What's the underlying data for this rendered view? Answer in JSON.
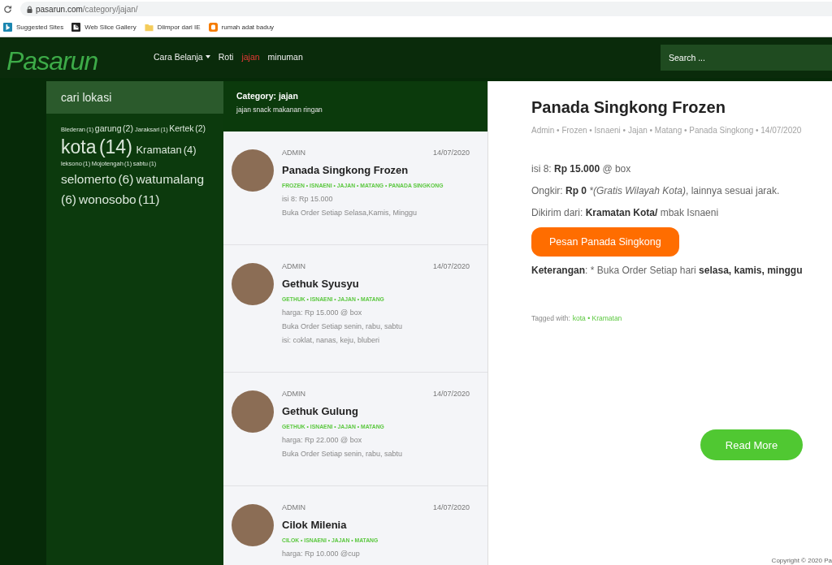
{
  "browser": {
    "url_host": "pasarun.com",
    "url_path": "/category/jajan/",
    "bookmarks": [
      {
        "label": "Suggested Sites",
        "kind": "tile"
      },
      {
        "label": "Web Slice Gallery",
        "kind": "page"
      },
      {
        "label": "Diimpor dari IE",
        "kind": "folder"
      },
      {
        "label": "rumah adat baduy",
        "kind": "badge"
      }
    ]
  },
  "header": {
    "logo": "Pasarun",
    "nav": [
      {
        "label": "Cara Belanja",
        "dropdown": true,
        "selected": false
      },
      {
        "label": "Roti",
        "dropdown": false,
        "selected": false
      },
      {
        "label": "jajan",
        "dropdown": false,
        "selected": true
      },
      {
        "label": "minuman",
        "dropdown": false,
        "selected": false
      }
    ],
    "search": {
      "placeholder": "Search ..."
    }
  },
  "sidebar": {
    "title": "cari lokasi",
    "tags": [
      {
        "name": "Blederan",
        "count": "(1)",
        "kind": "tiny"
      },
      {
        "name": "garung",
        "count": "(2)",
        "kind": "small"
      },
      {
        "name": "Jaraksari",
        "count": "(1)",
        "kind": "tiny"
      },
      {
        "name": "Kertek",
        "count": "(2)",
        "kind": "small"
      },
      {
        "name": "kota",
        "count": "(14)",
        "kind": "huge"
      },
      {
        "name": "Kramatan",
        "count": "(4)",
        "kind": "medium"
      },
      {
        "name": "leksono",
        "count": "(1)",
        "kind": "tiny"
      },
      {
        "name": "Mojotengah",
        "count": "(1)",
        "kind": "tiny"
      },
      {
        "name": "sabtu",
        "count": "(1)",
        "kind": "tiny"
      },
      {
        "name": "selomerto",
        "count": "(6)",
        "kind": "large"
      },
      {
        "name": "watumalang",
        "count": "(6)",
        "kind": "large"
      },
      {
        "name": "wonosobo",
        "count": "(11)",
        "kind": "large"
      }
    ]
  },
  "category": {
    "title": "Category: jajan",
    "description": "jajan snack makanan ringan"
  },
  "posts": [
    {
      "author": "ADMIN",
      "date": "14/07/2020",
      "title": "Panada Singkong Frozen",
      "tags": "FROZEN • ISNAENI • JAJAN • MATANG • PANADA SINGKONG",
      "lines": [
        "isi 8: Rp 15.000",
        "Buka Order Setiap Selasa,Kamis, Minggu"
      ]
    },
    {
      "author": "ADMIN",
      "date": "14/07/2020",
      "title": "Gethuk Syusyu",
      "tags": "GETHUK • ISNAENI • JAJAN • MATANG",
      "lines": [
        "harga: Rp 15.000 @ box",
        "Buka Order Setiap senin, rabu, sabtu",
        "isi: coklat, nanas, keju, bluberi"
      ]
    },
    {
      "author": "ADMIN",
      "date": "14/07/2020",
      "title": "Gethuk Gulung",
      "tags": "GETHUK • ISNAENI • JAJAN • MATANG",
      "lines": [
        "harga: Rp 22.000 @ box",
        "Buka Order Setiap senin, rabu, sabtu"
      ]
    },
    {
      "author": "ADMIN",
      "date": "14/07/2020",
      "title": "Cilok Milenia",
      "tags": "CILOK • ISNAENI • JAJAN • MATANG",
      "lines": [
        "harga: Rp 10.000 @cup"
      ]
    }
  ],
  "article": {
    "title": "Panada Singkong Frozen",
    "meta": "Admin • Frozen • Isnaeni • Jajan • Matang • Panada Singkong • 14/07/2020",
    "paragraphs": [
      [
        {
          "text": "isi 8: ",
          "kind": "plain"
        },
        {
          "text": "Rp 15.000",
          "kind": "bold"
        },
        {
          "text": " @ box",
          "kind": "plain"
        }
      ],
      [
        {
          "text": "Ongkir: ",
          "kind": "plain"
        },
        {
          "text": "Rp 0",
          "kind": "bold"
        },
        {
          "text": " *(Gratis Wilayah Kota)",
          "kind": "italic"
        },
        {
          "text": ", lainnya sesuai jarak.",
          "kind": "plain"
        }
      ],
      [
        {
          "text": "Dikirim dari: ",
          "kind": "plain"
        },
        {
          "text": "Kramatan Kota/",
          "kind": "bold"
        },
        {
          "text": " mbak Isnaeni",
          "kind": "plain"
        }
      ]
    ],
    "order_button": "Pesan Panada Singkong",
    "note": [
      {
        "text": "Keterangan",
        "kind": "bold"
      },
      {
        "text": ": * Buka Order Setiap hari ",
        "kind": "plain"
      },
      {
        "text": "selasa, kamis, minggu",
        "kind": "bold"
      }
    ],
    "tagged_label": "Tagged with:",
    "tagged_tags": "kota • Kramatan",
    "read_more": "Read More"
  },
  "footer": {
    "copyright": "Copyright © 2020 Pa"
  }
}
